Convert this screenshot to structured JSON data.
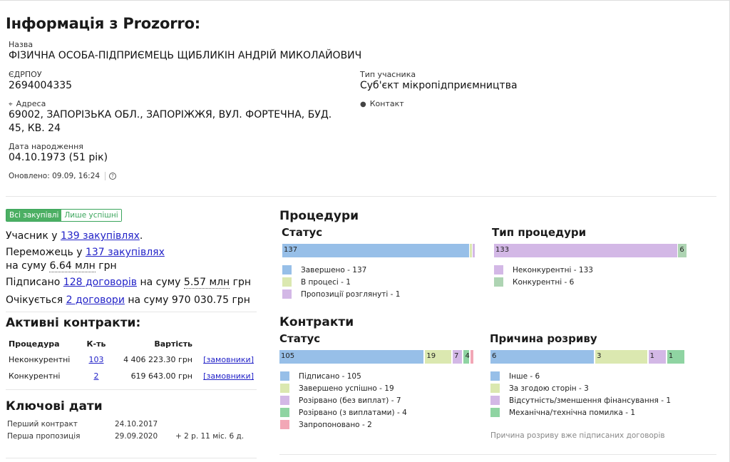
{
  "header": {
    "title": "Інформація з Prozorro:"
  },
  "info": {
    "name_label": "Назва",
    "name_value": "ФІЗИЧНА ОСОБА-ПІДПРИЄМЕЦЬ ЩИБЛИКІН АНДРІЙ МИКОЛАЙОВИЧ",
    "edrpou_label": "ЄДРПОУ",
    "edrpou_value": "2694004335",
    "type_label": "Тип учасника",
    "type_value": "Суб'єкт мікропідприємництва",
    "address_label": "Адреса",
    "address_line1": "69002, ЗАПОРІЗЬКА ОБЛ., ЗАПОРІЖЖЯ, ВУЛ. ФОРТЕЧНА, БУД.",
    "address_line2": "45, КВ. 24",
    "contact_label": "Контакт",
    "birth_label": "Дата народження",
    "birth_value": "04.10.1973 (51 рік)",
    "updated": "Оновлено: 09.09, 16:24",
    "help_glyph": "?"
  },
  "toggle": {
    "all": "Всі закупівлі",
    "success": "Лише успішні"
  },
  "stats": {
    "participant_prefix": "Учасник у",
    "participant_link": "139 закупівлях",
    "participant_suffix": ".",
    "winner_prefix": "Переможець у",
    "winner_link": "137 закупівлях",
    "sum_prefix": "на суму",
    "sum_value": "6.64 млн",
    "sum_suffix": "грн",
    "signed_prefix": "Підписано",
    "signed_link": "128 договорів",
    "signed_mid": "на суму",
    "signed_value": "5.57 млн",
    "signed_suffix": "грн",
    "expected_prefix": "Очікується",
    "expected_link": "2 договори",
    "expected_suffix": "на суму 970 030.75 грн"
  },
  "active_contracts": {
    "title": "Активні контракти:",
    "columns": [
      "Процедура",
      "К-ть",
      "Вартість",
      ""
    ],
    "rows": [
      {
        "procedure": "Неконкурентні",
        "count": "103",
        "value": "4 406 223.30 грн",
        "link": "[замовники]"
      },
      {
        "procedure": "Конкурентні",
        "count": "2",
        "value": "619 643.00 грн",
        "link": "[замовники]"
      }
    ]
  },
  "key_dates": {
    "title": "Ключові дати",
    "first_contract_label": "Перший контракт",
    "first_contract_value": "24.10.2017",
    "first_proposal_label": "Перша пропозиція",
    "first_proposal_value": "29.09.2020",
    "first_proposal_extra": "+ 2 р. 11 міс. 6 д."
  },
  "procedures": {
    "title": "Процедури",
    "status": {
      "title": "Статус",
      "segments": [
        {
          "label": "137",
          "value": 137,
          "color": "#97bfe8"
        },
        {
          "label": "",
          "value": 1,
          "color": "#dbe8b0"
        },
        {
          "label": "",
          "value": 1,
          "color": "#d3b8e6"
        }
      ],
      "legend": [
        {
          "label": "Завершено - 137",
          "color": "#97bfe8"
        },
        {
          "label": "В процесі - 1",
          "color": "#dbe8b0"
        },
        {
          "label": "Пропозиції розглянуті - 1",
          "color": "#d3b8e6"
        }
      ]
    },
    "type": {
      "title": "Тип процедури",
      "segments": [
        {
          "label": "133",
          "value": 133,
          "color": "#d3b8e6"
        },
        {
          "label": "6",
          "value": 6,
          "color": "#aed4b3"
        }
      ],
      "legend": [
        {
          "label": "Неконкурентні - 133",
          "color": "#d3b8e6"
        },
        {
          "label": "Конкурентні - 6",
          "color": "#aed4b3"
        }
      ]
    }
  },
  "contracts": {
    "title": "Контракти",
    "status": {
      "title": "Статус",
      "segments": [
        {
          "label": "105",
          "value": 105,
          "color": "#97bfe8"
        },
        {
          "label": "19",
          "value": 19,
          "color": "#dbe8b0"
        },
        {
          "label": "7",
          "value": 7,
          "color": "#d3b8e6"
        },
        {
          "label": "4",
          "value": 4,
          "color": "#8fd4a2"
        },
        {
          "label": "",
          "value": 2,
          "color": "#f2a7b6"
        }
      ],
      "legend": [
        {
          "label": "Підписано - 105",
          "color": "#97bfe8"
        },
        {
          "label": "Завершено успішно - 19",
          "color": "#dbe8b0"
        },
        {
          "label": "Розірвано (без виплат) - 7",
          "color": "#d3b8e6"
        },
        {
          "label": "Розірвано (з виплатами) - 4",
          "color": "#8fd4a2"
        },
        {
          "label": "Запропоновано - 2",
          "color": "#f2a7b6"
        }
      ]
    },
    "reason": {
      "title": "Причина розриву",
      "segments": [
        {
          "label": "6",
          "value": 6,
          "color": "#97bfe8"
        },
        {
          "label": "3",
          "value": 3,
          "color": "#dbe8b0"
        },
        {
          "label": "1",
          "value": 1,
          "color": "#d3b8e6"
        },
        {
          "label": "1",
          "value": 1,
          "color": "#8fd4a2"
        }
      ],
      "legend": [
        {
          "label": "Інше - 6",
          "color": "#97bfe8"
        },
        {
          "label": "За згодою сторін - 3",
          "color": "#dbe8b0"
        },
        {
          "label": "Відсутність/зменшення фінансування - 1",
          "color": "#d3b8e6"
        },
        {
          "label": "Механічна/технічна помилка - 1",
          "color": "#8fd4a2"
        }
      ],
      "note": "Причина розриву вже підписаних договорів"
    }
  }
}
